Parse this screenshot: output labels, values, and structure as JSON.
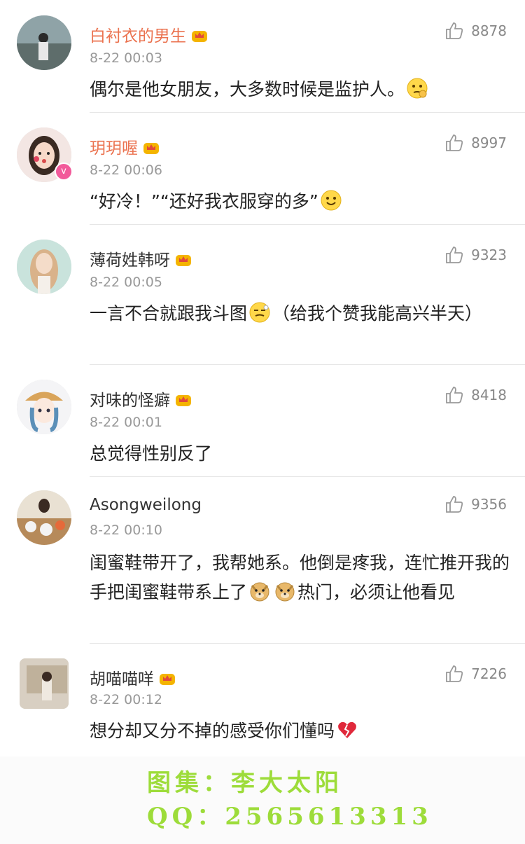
{
  "comments": [
    {
      "name": "白衬衣的男生",
      "time": "8-22 00:03",
      "likes": "8878",
      "text": "偶尔是他女朋友，大多数时候是监护人。"
    },
    {
      "name": "玥玥喔",
      "time": "8-22 00:06",
      "likes": "8997",
      "text": "“好冷！”“还好我衣服穿的多”"
    },
    {
      "name": "薄荷姓韩呀",
      "time": "8-22 00:05",
      "likes": "9323",
      "text_a": "一言不合就跟我斗图",
      "text_b": "（给我个赞我能高兴半天）"
    },
    {
      "name": "对味的怪癖",
      "time": "8-22 00:01",
      "likes": "8418",
      "text": "总觉得性别反了"
    },
    {
      "name": "Asongweilong",
      "time": "8-22 00:10",
      "likes": "9356",
      "text_a": "闺蜜鞋带开了，我帮她系。他倒是疼我，连忙推开我的手把闺蜜鞋带系上了",
      "text_b": "热门，必须让他看见"
    },
    {
      "name": "胡喵喵咩",
      "time": "8-22 00:12",
      "likes": "7226",
      "text": "想分却又分不掉的感受你们懂吗"
    }
  ],
  "watermark": {
    "line1": "图集：李大太阳",
    "line2": "QQ：2565613313"
  },
  "colors": {
    "vip_name": "#eb7350",
    "time": "#999999",
    "watermark": "#9ddc3a"
  }
}
